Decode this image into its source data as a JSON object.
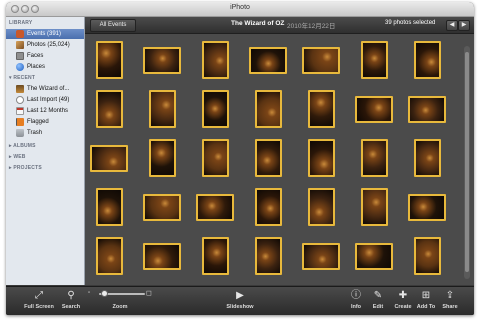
{
  "window": {
    "title": "iPhoto"
  },
  "sidebar": {
    "library_header": "LIBRARY",
    "library": [
      {
        "label": "Events (391)",
        "icon": "events-icon",
        "color": "#c9582a",
        "selected": true
      },
      {
        "label": "Photos (25,024)",
        "icon": "photos-icon",
        "color": "#b27c3a"
      },
      {
        "label": "Faces",
        "icon": "faces-icon",
        "color": "#8e8e8e"
      },
      {
        "label": "Places",
        "icon": "places-icon",
        "color": "#3f7ed6"
      }
    ],
    "recent_header": "RECENT",
    "recent": [
      {
        "label": "The Wizard of...",
        "icon": "event-thumbnail-icon",
        "color": "#8c6a3a"
      },
      {
        "label": "Last Import (49)",
        "icon": "clock-icon",
        "color": "#9ca3af"
      },
      {
        "label": "Last 12 Months",
        "icon": "calendar-icon",
        "color": "#c0392b"
      },
      {
        "label": "Flagged",
        "icon": "flag-icon",
        "color": "#e67e22"
      },
      {
        "label": "Trash",
        "icon": "trash-icon",
        "color": "#9aa0a6"
      }
    ],
    "albums_header": "ALBUMS",
    "web_header": "WEB",
    "projects_header": "PROJECTS"
  },
  "topbar": {
    "events_button": "All Events",
    "album_title": "The Wizard of OZ",
    "album_date": "2010年12月22日",
    "selected_count": "39 photos selected",
    "prev_icon": "arrow-left-icon",
    "next_icon": "arrow-right-icon"
  },
  "photo_grid": {
    "selected_count": 39,
    "border_color": "#e8b93c"
  },
  "toolbar": {
    "full_screen": "Full Screen",
    "search": "Search",
    "zoom": "Zoom",
    "slideshow": "Slideshow",
    "info": "Info",
    "edit": "Edit",
    "create": "Create",
    "add_to": "Add To",
    "share": "Share"
  }
}
